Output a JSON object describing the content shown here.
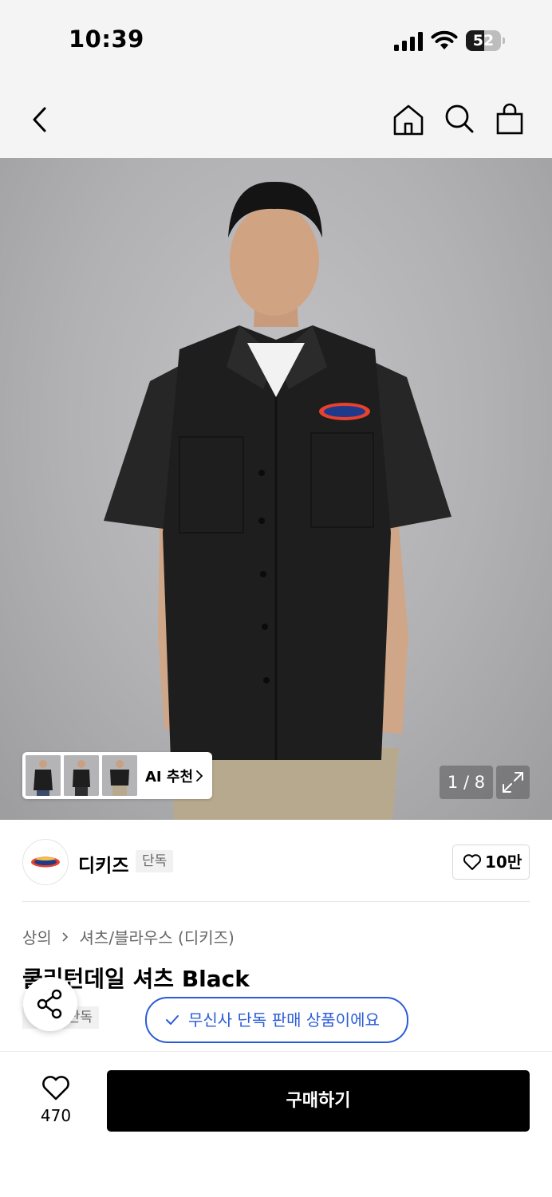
{
  "status_bar": {
    "time": "10:39",
    "battery": "52",
    "battery_level": 0.52
  },
  "header": {
    "icons": [
      "back-chevron-icon",
      "home-icon",
      "search-icon",
      "shopping-bag-icon"
    ]
  },
  "image": {
    "counter": "1 / 8",
    "ai_recommend_label": "AI 추천"
  },
  "brand": {
    "name": "디키즈",
    "badge": "단독",
    "like_count": "10만"
  },
  "breadcrumb": {
    "category": "상의",
    "subcategory": "셔츠/블라우스 (디키즈)"
  },
  "product": {
    "title": "쿨리턴데일 셔츠 Black",
    "exclusive_tag": "단독",
    "exclusive_banner": "무신사 단독 판매 상품이에요"
  },
  "bottom_bar": {
    "wish_count": "470",
    "buy_label": "구매하기"
  },
  "colors": {
    "accent_blue": "#2a5bd7",
    "buy_button": "#000000",
    "shirt": "#1e1e1f"
  }
}
